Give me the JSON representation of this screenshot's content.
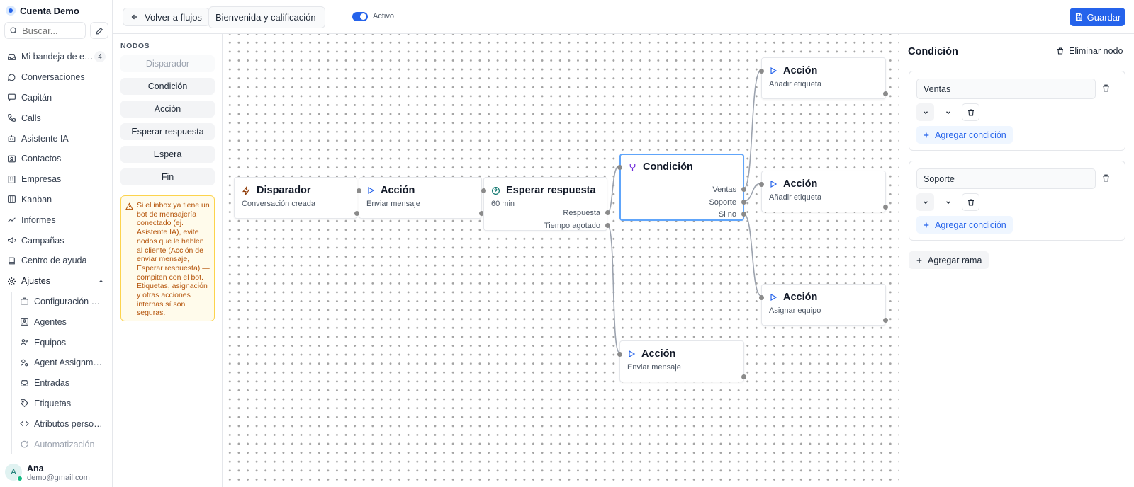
{
  "sidebar": {
    "account_name": "Cuenta Demo",
    "search_placeholder": "Buscar...",
    "items": [
      {
        "label": "Mi bandeja de entrada",
        "icon": "inbox-icon",
        "badge": "4"
      },
      {
        "label": "Conversaciones",
        "icon": "chat-bubble-icon"
      },
      {
        "label": "Capitán",
        "icon": "message-square-icon"
      },
      {
        "label": "Calls",
        "icon": "phone-icon"
      },
      {
        "label": "Asistente IA",
        "icon": "bot-icon"
      },
      {
        "label": "Contactos",
        "icon": "contact-card-icon"
      },
      {
        "label": "Empresas",
        "icon": "building-icon"
      },
      {
        "label": "Kanban",
        "icon": "kanban-icon"
      },
      {
        "label": "Informes",
        "icon": "line-chart-icon"
      },
      {
        "label": "Campañas",
        "icon": "megaphone-icon"
      },
      {
        "label": "Centro de ayuda",
        "icon": "book-icon"
      },
      {
        "label": "Ajustes",
        "icon": "gear-icon"
      }
    ],
    "settings_items": [
      {
        "label": "Configuración de la cuenta",
        "icon": "briefcase-icon"
      },
      {
        "label": "Agentes",
        "icon": "user-square-icon"
      },
      {
        "label": "Equipos",
        "icon": "users-icon"
      },
      {
        "label": "Agent Assignment",
        "icon": "user-gear-icon"
      },
      {
        "label": "Entradas",
        "icon": "inbox-icon"
      },
      {
        "label": "Etiquetas",
        "icon": "tag-icon"
      },
      {
        "label": "Atributos personalizados",
        "icon": "code-icon"
      },
      {
        "label": "Automatización",
        "icon": "refresh-icon"
      }
    ],
    "user": {
      "initial": "A",
      "name": "Ana",
      "email": "demo@gmail.com"
    }
  },
  "topbar": {
    "back_label": "Volver a flujos",
    "flow_name": "Bienvenida y calificación de prospectos",
    "active_label": "Activo",
    "save_label": "Guardar"
  },
  "palette": {
    "title": "NODOS",
    "items": [
      "Disparador",
      "Condición",
      "Acción",
      "Esperar respuesta",
      "Espera",
      "Fin"
    ],
    "warning": "Si el inbox ya tiene un bot de mensajería conectado (ej. Asistente IA), evite nodos que le hablen al cliente (Acción de enviar mensaje, Esperar respuesta) — compiten con el bot. Etiquetas, asignación y otras acciones internas sí son seguras."
  },
  "canvas": {
    "trigger": {
      "title": "Disparador",
      "subtitle": "Conversación creada"
    },
    "action_send": {
      "title": "Acción",
      "subtitle": "Enviar mensaje"
    },
    "wait_reply": {
      "title": "Esperar respuesta",
      "subtitle": "60 min",
      "port_reply": "Respuesta",
      "port_timeout": "Tiempo agotado"
    },
    "condition": {
      "title": "Condición",
      "port_sales": "Ventas",
      "port_support": "Soporte",
      "port_else": "Si no"
    },
    "action_tag_1": {
      "title": "Acción",
      "subtitle": "Añadir etiqueta"
    },
    "action_tag_2": {
      "title": "Acción",
      "subtitle": "Añadir etiqueta"
    },
    "action_team": {
      "title": "Acción",
      "subtitle": "Asignar equipo"
    },
    "action_send_2": {
      "title": "Acción",
      "subtitle": "Enviar mensaje"
    }
  },
  "panel": {
    "title": "Condición",
    "delete_label": "Eliminar nodo",
    "branches": [
      {
        "value": "Ventas",
        "add_label": "Agregar condición"
      },
      {
        "value": "Soporte",
        "add_label": "Agregar condición"
      }
    ],
    "add_branch_label": "Agregar rama"
  },
  "colors": {
    "accent": "#2563eb",
    "selected_border": "#60a5fa",
    "warning_bg": "#fffbeb",
    "warning_text": "#b45309"
  }
}
